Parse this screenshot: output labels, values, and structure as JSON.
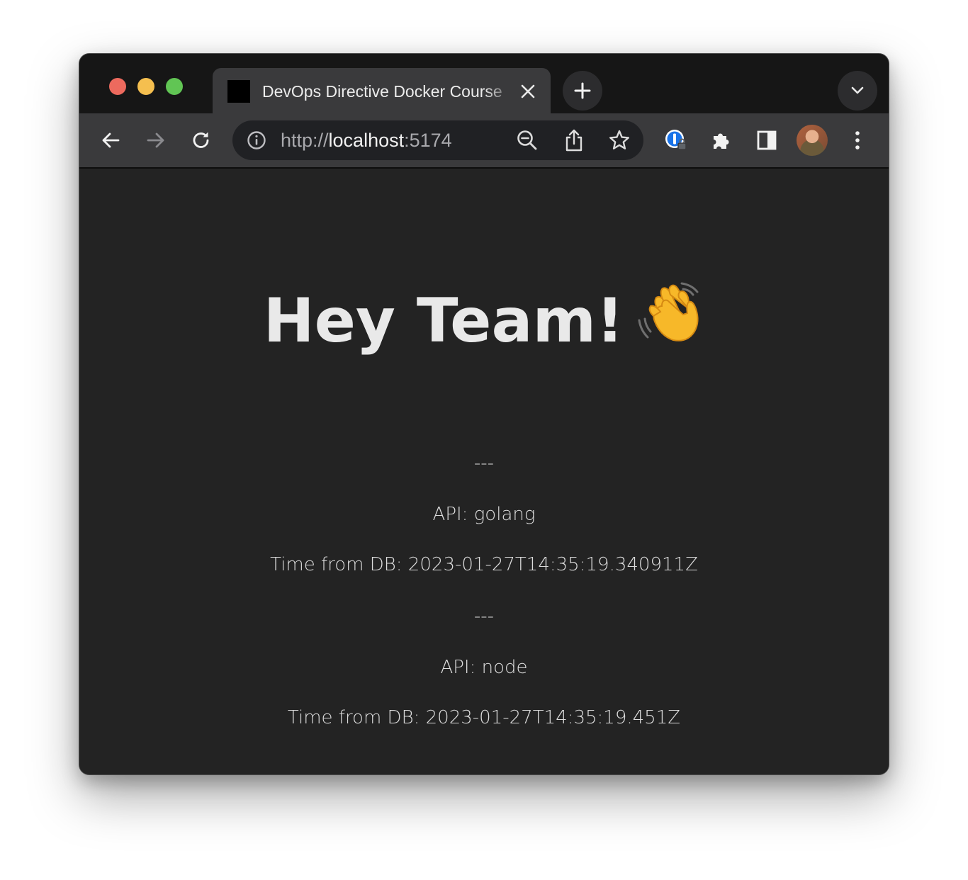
{
  "browser": {
    "tab": {
      "title": "DevOps Directive Docker Course"
    },
    "address_bar": {
      "scheme": "http://",
      "host": "localhost",
      "port": ":5174"
    },
    "icons": {
      "back": "arrow-left-icon",
      "forward": "arrow-right-icon",
      "reload": "reload-icon",
      "site_info": "info-icon",
      "zoom": "zoom-out-icon",
      "share": "share-icon",
      "bookmark": "star-icon",
      "password_manager": "1password-icon",
      "extensions": "puzzle-icon",
      "side_panel": "side-panel-icon",
      "menu": "kebab-menu-icon",
      "new_tab": "plus-icon",
      "tab_search": "chevron-down-icon"
    },
    "traffic_lights": {
      "close": "#ed6a5e",
      "minimize": "#f5bf4f",
      "zoom": "#61c554"
    }
  },
  "page": {
    "heading": "Hey Team!",
    "heading_emoji": "waving-hand-icon",
    "entries": [
      {
        "separator": "---",
        "api": "API: golang",
        "time": "Time from DB: 2023-01-27T14:35:19.340911Z"
      },
      {
        "separator": "---",
        "api": "API: node",
        "time": "Time from DB: 2023-01-27T14:35:19.451Z"
      }
    ]
  }
}
